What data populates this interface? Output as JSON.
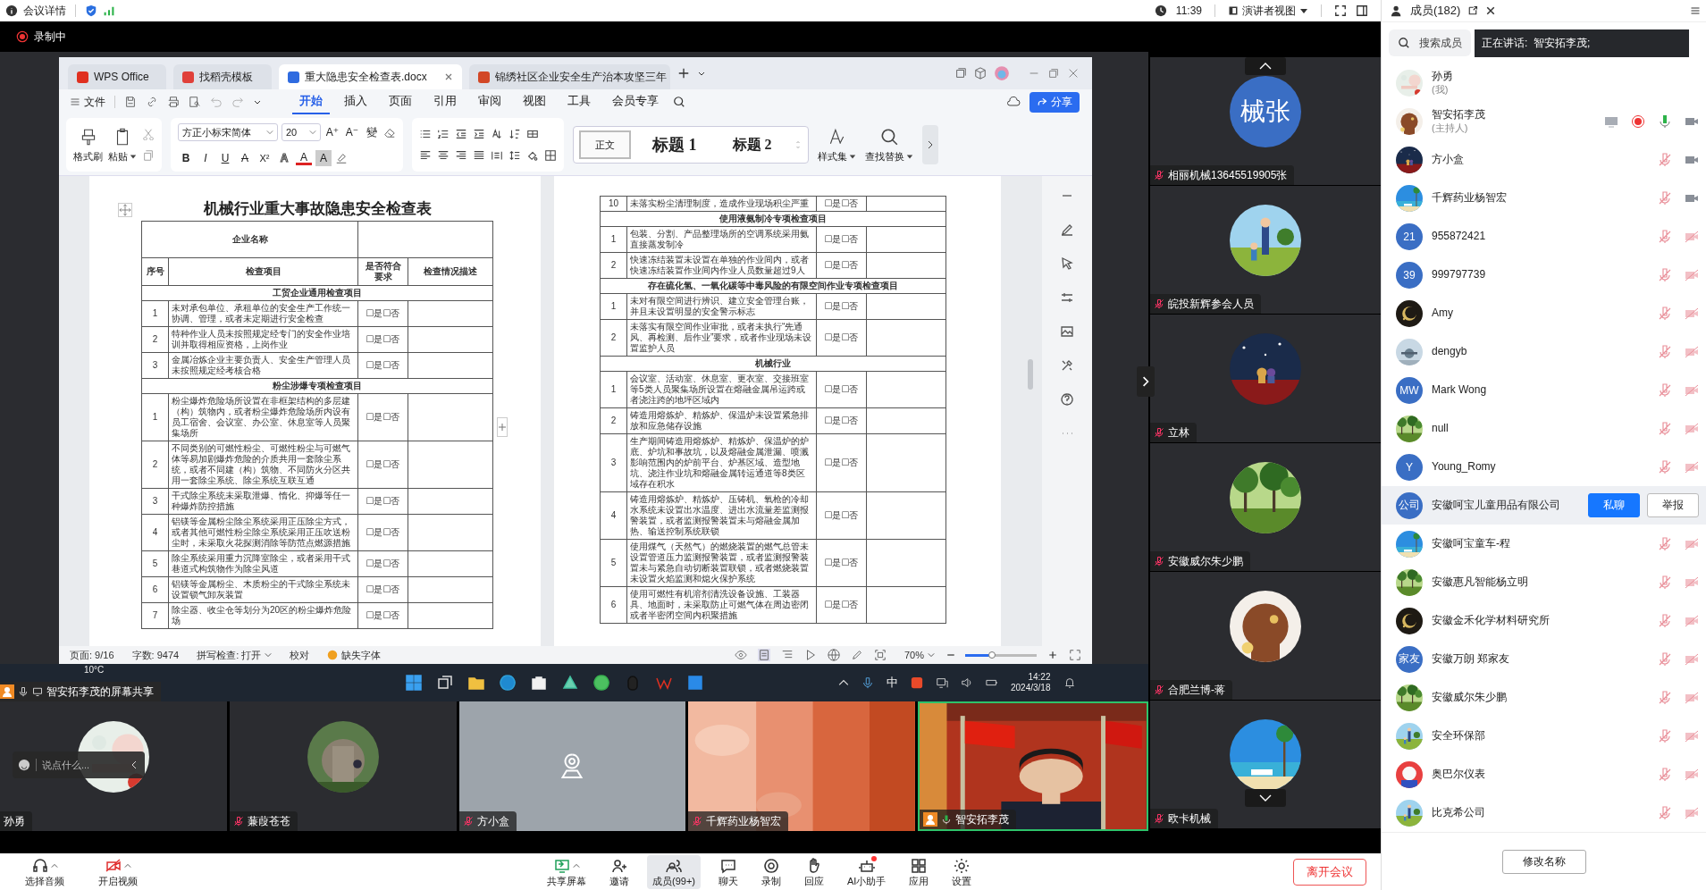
{
  "meeting_bar": {
    "title": "会议详情",
    "time": "11:39",
    "view_mode": "演讲者视图"
  },
  "recording": {
    "label": "录制中"
  },
  "wps": {
    "tabs": [
      {
        "label": "WPS Office",
        "kind": "home",
        "selected": false
      },
      {
        "label": "找稻壳模板",
        "kind": "template",
        "selected": false
      },
      {
        "label": "重大隐患安全检查表.docx",
        "kind": "doc",
        "selected": true
      },
      {
        "label": "锦绣社区企业安全生产治本攻坚三年",
        "kind": "ppt",
        "selected": false
      }
    ],
    "file_menu": "文件",
    "ribbon_tabs": [
      {
        "label": "开始",
        "selected": true
      },
      {
        "label": "插入",
        "selected": false
      },
      {
        "label": "页面",
        "selected": false
      },
      {
        "label": "引用",
        "selected": false
      },
      {
        "label": "审阅",
        "selected": false
      },
      {
        "label": "视图",
        "selected": false
      },
      {
        "label": "工具",
        "selected": false
      },
      {
        "label": "会员专享",
        "selected": false
      }
    ],
    "share_button": "分享",
    "ribbon": {
      "clipboard": [
        {
          "label": "格式刷",
          "menu": false
        },
        {
          "label": "粘贴",
          "menu": true
        }
      ],
      "font": "方正小标宋简体",
      "size": "20",
      "size_buttons": [
        "A⁺",
        "A⁻"
      ],
      "phonetic": "變",
      "format_buttons": [
        {
          "label": "B",
          "kind": "bold"
        },
        {
          "label": "I",
          "kind": "italic"
        },
        {
          "label": "U",
          "kind": "underline"
        },
        {
          "label": "A",
          "kind": "strike"
        },
        {
          "label": "X²",
          "kind": "superscript"
        },
        {
          "label": "A",
          "kind": "outline"
        },
        {
          "label": "A",
          "kind": "color"
        },
        {
          "label": "A",
          "kind": "shade"
        }
      ],
      "styles": [
        {
          "label": "正文",
          "selected": true
        },
        {
          "label": "标题 1",
          "selected": false
        },
        {
          "label": "标题 2",
          "selected": false
        }
      ],
      "style_set": "样式集",
      "find_replace": "查找替换"
    },
    "pages": [
      {
        "title": "机械行业重大事故隐患安全检查表",
        "company_label": "企业名称",
        "headers": [
          "序号",
          "检查项目",
          "是否符合要求",
          "检查情况描述"
        ],
        "sections": [
          {
            "title": "工贸企业通用检查项目",
            "rows": [
              {
                "no": "1",
                "item": "未对承包单位、承租单位的安全生产工作统一协调、管理，或者未定期进行安全检查",
                "answer": "☐是☐否"
              },
              {
                "no": "2",
                "item": "特种作业人员未按照规定经专门的安全作业培训并取得相应资格，上岗作业",
                "answer": "☐是☐否"
              },
              {
                "no": "3",
                "item": "金属冶炼企业主要负责人、安全生产管理人员未按照规定经考核合格",
                "answer": "☐是☐否"
              }
            ]
          },
          {
            "title": "粉尘涉爆专项检查项目",
            "rows": [
              {
                "no": "1",
                "item": "粉尘爆炸危险场所设置在非框架结构的多层建（构）筑物内，或者粉尘爆炸危险场所内设有员工宿舍、会议室、办公室、休息室等人员聚集场所",
                "answer": "☐是☐否"
              },
              {
                "no": "2",
                "item": "不同类别的可燃性粉尘、可燃性粉尘与可燃气体等易加剧爆炸危险的介质共用一套除尘系统，或者不同建（构）筑物、不同防火分区共用一套除尘系统、除尘系统互联互通",
                "answer": "☐是☐否"
              },
              {
                "no": "3",
                "item": "干式除尘系统未采取泄爆、惰化、抑爆等任一种爆炸防控措施",
                "answer": "☐是☐否"
              },
              {
                "no": "4",
                "item": "铝镁等金属粉尘除尘系统采用正压除尘方式，或者其他可燃性粉尘除尘系统采用正压吹送粉尘时，未采取火花探测消除等防范点燃源措施",
                "answer": "☐是☐否"
              },
              {
                "no": "5",
                "item": "除尘系统采用重力沉降室除尘，或者采用干式巷道式构筑物作为除尘风道",
                "answer": "☐是☐否"
              },
              {
                "no": "6",
                "item": "铝镁等金属粉尘、木质粉尘的干式除尘系统未设置锁气卸灰装置",
                "answer": "☐是☐否"
              },
              {
                "no": "7",
                "item": "除尘器、收尘仓等划分为20区的粉尘爆炸危险场",
                "answer": "☐是☐否"
              }
            ]
          }
        ]
      },
      {
        "sections": [
          {
            "rows": [
              {
                "no": "10",
                "item": "未落实粉尘清理制度，造成作业现场积尘严重",
                "answer": "☐是☐否"
              }
            ]
          },
          {
            "title": "使用液氨制冷专项检查项目",
            "rows": [
              {
                "no": "1",
                "item": "包装、分割、产品整理场所的空调系统采用氨直接蒸发制冷",
                "answer": "☐是☐否"
              },
              {
                "no": "2",
                "item": "快速冻结装置未设置在单独的作业间内，或者快速冻结装置作业间内作业人员数量超过9人",
                "answer": "☐是☐否"
              }
            ]
          },
          {
            "title": "存在硫化氢、一氧化碳等中毒风险的有限空间作业专项检查项目",
            "rows": [
              {
                "no": "1",
                "item": "未对有限空间进行辨识、建立安全管理台账，并且未设置明显的安全警示标志",
                "answer": "☐是☐否"
              },
              {
                "no": "2",
                "item": "未落实有限空间作业审批，或者未执行“先通风、再检测、后作业”要求，或者作业现场未设置监护人员",
                "answer": "☐是☐否"
              }
            ]
          },
          {
            "title": "机械行业",
            "rows": [
              {
                "no": "1",
                "item": "会议室、活动室、休息室、更衣室、交接班室等5类人员聚集场所设置在熔融金属吊运跨或者浇注跨的地坪区域内",
                "answer": "☐是☐否"
              },
              {
                "no": "2",
                "item": "铸造用熔炼炉、精炼炉、保温炉未设置紧急排放和应急储存设施",
                "answer": "☐是☐否"
              },
              {
                "no": "3",
                "item": "生产期间铸造用熔炼炉、精炼炉、保温炉的炉底、炉坑和事故坑，以及熔融金属泄漏、喷溅影响范围内的炉前平台、炉基区域、造型地坑、浇注作业坑和熔融金属转运通道等8类区域存在积水",
                "answer": "☐是☐否"
              },
              {
                "no": "4",
                "item": "铸造用熔炼炉、精炼炉、压铸机、氧枪的冷却水系统未设置出水温度、进出水流量差监测报警装置，或者监测报警装置未与熔融金属加热、输送控制系统联锁",
                "answer": "☐是☐否"
              },
              {
                "no": "5",
                "item": "使用煤气（天然气）的燃烧装置的燃气总管未设置管道压力监测报警装置，或者监测报警装置未与紧急自动切断装置联锁，或者燃烧装置未设置火焰监测和熄火保护系统",
                "answer": "☐是☐否"
              },
              {
                "no": "6",
                "item": "使用可燃性有机溶剂清洗设备设施、工装器具、地面时，未采取防止可燃气体在周边密闭或者半密闭空间内积聚措施",
                "answer": "☐是☐否"
              }
            ]
          }
        ]
      }
    ],
    "status": {
      "page": "页面: 9/16",
      "words": "字数: 9474",
      "spell": "拼写检查: 打开",
      "proof": "校对",
      "missing_font": "缺失字体",
      "zoom": "70%",
      "zoom_slider": {
        "level": 0.37
      }
    }
  },
  "taskbar": {
    "weather": "10°C",
    "ime": "中",
    "time": "14:22",
    "date": "2024/3/18"
  },
  "share_label": "智安拓李茂的屏幕共享",
  "chat_box": {
    "placeholder": "说点什么..."
  },
  "bottom_tiles": [
    {
      "name": "孙勇",
      "kind": "avatar",
      "muted": false,
      "talking": false,
      "host": false,
      "speaking": false
    },
    {
      "name": "蒹葭苍苍",
      "kind": "avatar",
      "muted": true,
      "talking": false,
      "host": false,
      "speaking": false
    },
    {
      "name": "方小盒",
      "kind": "camera_off",
      "muted": true,
      "talking": false,
      "host": false,
      "speaking": false
    },
    {
      "name": "千辉药业杨智宏",
      "kind": "video",
      "muted": true,
      "talking": false,
      "host": false,
      "speaking": false
    },
    {
      "name": "智安拓李茂",
      "kind": "host_video",
      "muted": false,
      "talking": true,
      "host": true,
      "speaking": true
    }
  ],
  "side_tiles": [
    {
      "name": "相丽机械13645519905张",
      "kind": "initials",
      "initials": "械张",
      "muted": true
    },
    {
      "name": "皖投新辉参会人员",
      "kind": "avatar",
      "muted": true
    },
    {
      "name": "立林",
      "kind": "avatar",
      "muted": true
    },
    {
      "name": "安徽威尔朱少鹏",
      "kind": "avatar",
      "muted": true
    },
    {
      "name": "合肥兰博-蒋",
      "kind": "avatar",
      "muted": true
    },
    {
      "name": "欧卡机械",
      "kind": "avatar",
      "muted": true
    }
  ],
  "toolbar": {
    "left": [
      {
        "label": "选择音频",
        "menu": true,
        "selected": false,
        "dot": false
      },
      {
        "label": "开启视频",
        "menu": true,
        "selected": false,
        "dot": false
      }
    ],
    "center": [
      {
        "label": "共享屏幕",
        "menu": true,
        "selected": false,
        "dot": false
      },
      {
        "label": "邀请",
        "menu": false,
        "selected": false,
        "dot": false
      },
      {
        "label": "成员(99+)",
        "menu": false,
        "selected": true,
        "dot": false
      },
      {
        "label": "聊天",
        "menu": false,
        "selected": false,
        "dot": false
      },
      {
        "label": "录制",
        "menu": false,
        "selected": false,
        "dot": false
      },
      {
        "label": "回应",
        "menu": false,
        "selected": false,
        "dot": false
      },
      {
        "label": "AI小助手",
        "menu": false,
        "selected": false,
        "dot": true
      },
      {
        "label": "应用",
        "menu": false,
        "selected": false,
        "dot": false
      },
      {
        "label": "设置",
        "menu": false,
        "selected": false,
        "dot": false
      }
    ],
    "leave": "离开会议"
  },
  "members_panel": {
    "title": "成员(182)",
    "search_placeholder": "搜索成员",
    "speaking": "正在讲话:  智安拓李茂;",
    "rename": "修改名称",
    "members": [
      {
        "name": "孙勇",
        "role": "(我)",
        "kind": "self",
        "selected": false
      },
      {
        "name": "智安拓李茂",
        "role": "(主持人)",
        "kind": "host",
        "selected": false
      },
      {
        "name": "方小盒",
        "kind": "camera",
        "selected": false
      },
      {
        "name": "千辉药业杨智宏",
        "kind": "camera",
        "selected": false
      },
      {
        "name": "955872421",
        "avatar_text": "21",
        "kind": "muted",
        "selected": false
      },
      {
        "name": "999797739",
        "avatar_text": "39",
        "kind": "muted",
        "selected": false
      },
      {
        "name": "Amy",
        "kind": "muted",
        "selected": false
      },
      {
        "name": "dengyb",
        "kind": "muted",
        "selected": false
      },
      {
        "name": "Mark Wong",
        "avatar_text": "MW",
        "kind": "muted",
        "selected": false
      },
      {
        "name": "null",
        "kind": "muted",
        "selected": false
      },
      {
        "name": "Young_Romy",
        "avatar_text": "Y",
        "kind": "muted",
        "selected": false
      },
      {
        "name": "安徽呵宝儿童用品有限公司",
        "avatar_text": "公司",
        "kind": "hovered",
        "selected": true,
        "actions": [
          "私聊",
          "举报"
        ]
      },
      {
        "name": "安徽呵宝童车-程",
        "kind": "muted",
        "selected": false
      },
      {
        "name": "安徽惠凡智能杨立明",
        "kind": "muted",
        "selected": false
      },
      {
        "name": "安徽金禾化学材料研究所",
        "kind": "muted",
        "selected": false
      },
      {
        "name": "安徽万朗 郑家友",
        "avatar_text": "家友",
        "kind": "muted",
        "selected": false
      },
      {
        "name": "安徽威尔朱少鹏",
        "kind": "muted",
        "selected": false
      },
      {
        "name": "安全环保部",
        "kind": "muted",
        "selected": false
      },
      {
        "name": "奥巴尔仪表",
        "kind": "muted",
        "selected": false
      },
      {
        "name": "比克希公司",
        "kind": "muted",
        "selected": false
      }
    ]
  }
}
